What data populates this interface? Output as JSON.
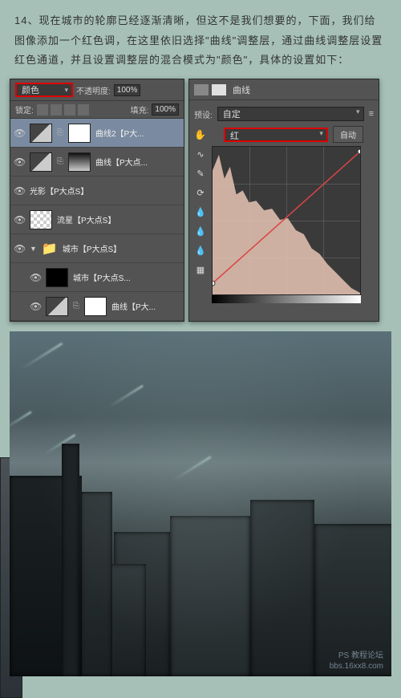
{
  "tutorial": {
    "step": "14、现在城市的轮廓已经逐渐清晰，但这不是我们想要的，下面，我们给图像添加一个红色调，在这里依旧选择\"曲线\"调整层，通过曲线调整层设置红色通道，并且设置调整层的混合模式为\"颜色\"，具体的设置如下："
  },
  "layers": {
    "blend_mode": "颜色",
    "opacity_label": "不透明度:",
    "opacity_value": "100%",
    "lock_label": "锁定:",
    "fill_label": "填充:",
    "fill_value": "100%",
    "items": [
      {
        "name": "曲线2【P大...",
        "type": "adj",
        "mask": "white",
        "selected": true
      },
      {
        "name": "曲线【P大点...",
        "type": "adj",
        "mask": "grad"
      },
      {
        "name": "光影【P大点S】",
        "type": "city"
      },
      {
        "name": "流星【P大点S】",
        "type": "check"
      },
      {
        "name": "城市【P大点S】",
        "type": "folder"
      },
      {
        "name": "城市【P大点S...",
        "type": "city",
        "mask": "black",
        "indent": true
      },
      {
        "name": "曲线【P大...",
        "type": "adj",
        "mask": "white",
        "indent": true
      }
    ]
  },
  "curves": {
    "title": "曲线",
    "preset_label": "预设:",
    "preset_value": "自定",
    "channel_value": "红",
    "auto_label": "自动"
  },
  "watermark": {
    "line1": "PS 教程论坛",
    "line2": "bbs.16xx8.com"
  }
}
